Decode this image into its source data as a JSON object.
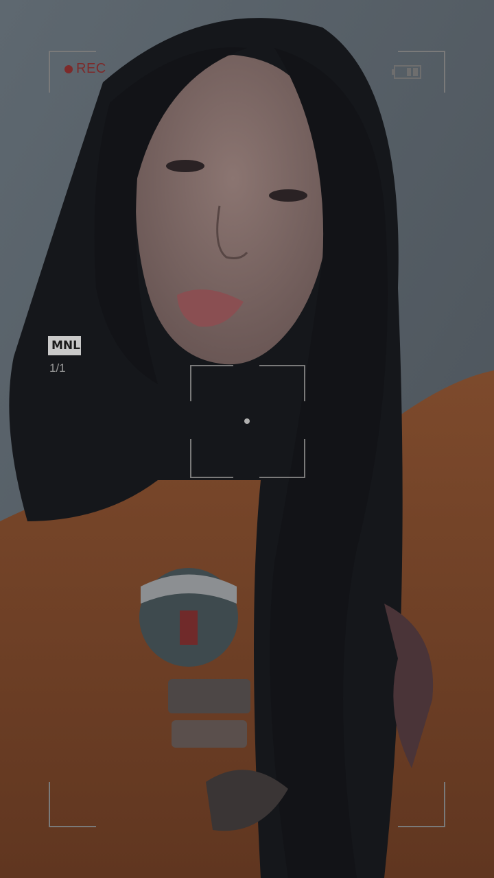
{
  "recording": {
    "label": "REC",
    "color": "#7d2a2a"
  },
  "mode": {
    "label": "MNL"
  },
  "frame_counter": {
    "text": "1/1"
  },
  "icons": [
    "battery-icon",
    "focus-bracket-icon",
    "corner-bracket-icon"
  ],
  "colors": {
    "overlay_lines": "#7a7a7a",
    "badge_bg": "#c9c9c9",
    "shirt": "#7a4628",
    "hair": "#121317",
    "background": "#5c6670"
  }
}
